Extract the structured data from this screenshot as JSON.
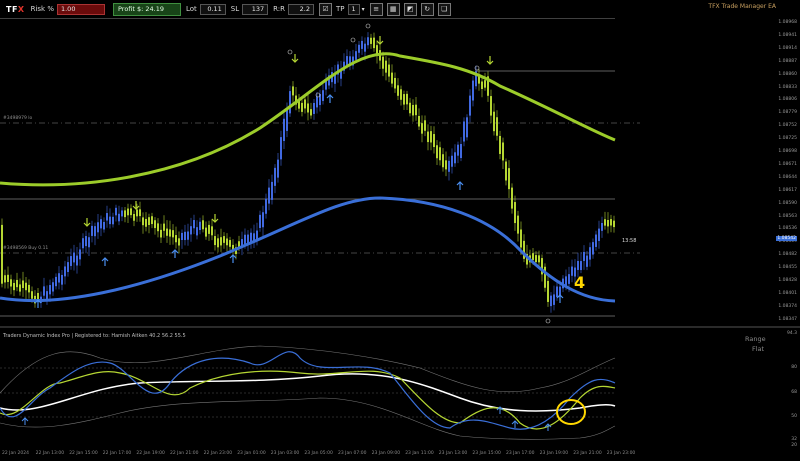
{
  "toolbar": {
    "logo_text": "TF",
    "logo_accent": "X",
    "risk_label": "Risk %",
    "risk_value": "1.00",
    "profit_label": "Profit $: 24.19",
    "lot_label": "Lot",
    "lot_value": "0.11",
    "sl_label": "SL",
    "sl_value": "137",
    "rr_label": "R:R",
    "rr_value": "2.2",
    "tp_label": "TP",
    "tp_value": "1"
  },
  "ea_title": "TFX Trade Manager EA",
  "price_axis": [
    "1.08968",
    "1.08941",
    "1.08914",
    "1.08887",
    "1.08860",
    "1.08833",
    "1.08806",
    "1.08779",
    "1.08752",
    "1.08725",
    "1.08698",
    "1.08671",
    "1.08644",
    "1.08617",
    "1.08590",
    "1.08563",
    "1.08536",
    "1.08509",
    "1.08482",
    "1.08455",
    "1.08428",
    "1.08401",
    "1.08374",
    "1.08347"
  ],
  "current_price": "1.08542",
  "timer": "13:58",
  "level_labels": {
    "upper": "#3498979 lo",
    "lower": "#3498569 Buy 0.11"
  },
  "indicator": {
    "title": "Traders Dynamic Index Pro | Registered to: Hamish Aitken  40.2  56.2  55.5",
    "range_label": "Range",
    "flat_label": "Flat",
    "axis": [
      "94.3",
      "80",
      "68",
      "50",
      "32",
      "20"
    ]
  },
  "time_axis": [
    "22 Jan 2024",
    "22 Jan 13:00",
    "22 Jan 15:00",
    "22 Jan 17:00",
    "22 Jan 19:00",
    "22 Jan 21:00",
    "22 Jan 23:00",
    "23 Jan 01:00",
    "23 Jan 03:00",
    "23 Jan 05:00",
    "23 Jan 07:00",
    "23 Jan 09:00",
    "23 Jan 11:00",
    "23 Jan 13:00",
    "23 Jan 15:00",
    "23 Jan 17:00",
    "23 Jan 19:00",
    "23 Jan 21:00",
    "23 Jan 23:00"
  ],
  "annotation": "4",
  "colors": {
    "bull": "#4169e1",
    "bear": "#b5d633",
    "upper_band": "#9ccc2a",
    "lower_band": "#3a6fd8",
    "tdi_green": "#b5d633",
    "tdi_blue": "#3a6fd8",
    "tdi_white": "#ffffff",
    "highlight": "#ffd700"
  }
}
